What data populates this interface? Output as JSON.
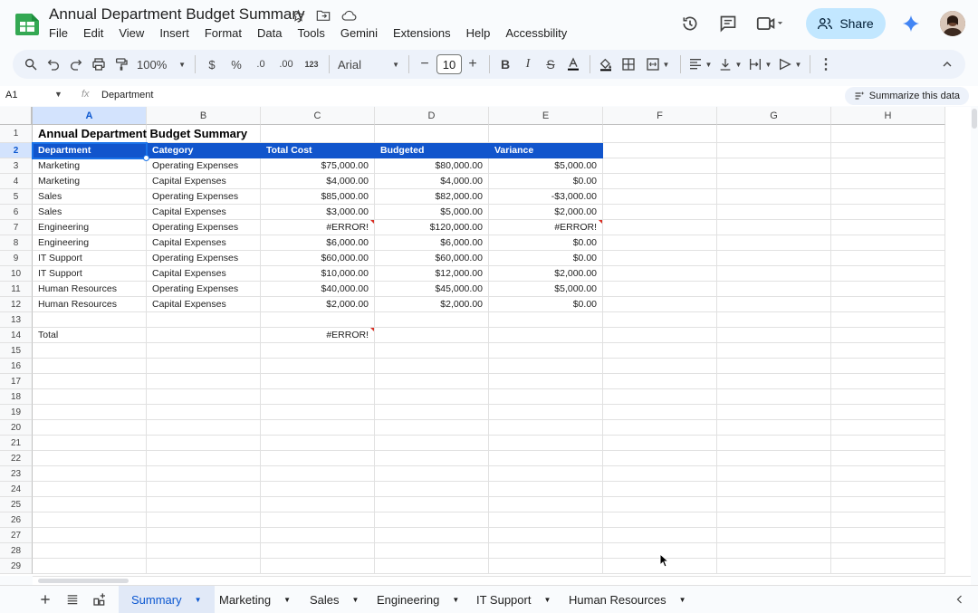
{
  "app": {
    "title": "Annual Department Budget Summary",
    "share_label": "Share"
  },
  "menu": [
    "File",
    "Edit",
    "View",
    "Insert",
    "Format",
    "Data",
    "Tools",
    "Gemini",
    "Extensions",
    "Help",
    "Accessbility"
  ],
  "toolbar": {
    "zoom": "100%",
    "font": "Arial",
    "font_size": "10",
    "currency": "$",
    "percent": "%",
    "dec_minus": ".0",
    "dec_plus": ".00",
    "number_format": "123"
  },
  "formula": {
    "name_box": "A1",
    "fx": "fx",
    "value": "Department",
    "summarize_label": "Summarize this data"
  },
  "columns": [
    "A",
    "B",
    "C",
    "D",
    "E",
    "F",
    "G",
    "H"
  ],
  "rows": [
    "1",
    "2",
    "3",
    "4",
    "5",
    "6",
    "7",
    "8",
    "9",
    "10",
    "11",
    "12",
    "13",
    "14",
    "15",
    "16",
    "17",
    "18",
    "19",
    "20",
    "21",
    "22",
    "23",
    "24",
    "25",
    "26",
    "27",
    "28",
    "29"
  ],
  "sheet_title": "Annual Department Budget Summary",
  "headers": [
    "Department",
    "Category",
    "Total Cost",
    "Budgeted",
    "Variance"
  ],
  "data": [
    [
      "Marketing",
      "Operating Expenses",
      "$75,000.00",
      "$80,000.00",
      "$5,000.00"
    ],
    [
      "Marketing",
      "Capital Expenses",
      "$4,000.00",
      "$4,000.00",
      "$0.00"
    ],
    [
      "Sales",
      "Operating Expenses",
      "$85,000.00",
      "$82,000.00",
      "-$3,000.00"
    ],
    [
      "Sales",
      "Capital Expenses",
      "$3,000.00",
      "$5,000.00",
      "$2,000.00"
    ],
    [
      "Engineering",
      "Operating Expenses",
      "#ERROR!",
      "$120,000.00",
      "#ERROR!"
    ],
    [
      "Engineering",
      "Capital Expenses",
      "$6,000.00",
      "$6,000.00",
      "$0.00"
    ],
    [
      "IT Support",
      "Operating Expenses",
      "$60,000.00",
      "$60,000.00",
      "$0.00"
    ],
    [
      "IT Support",
      "Capital Expenses",
      "$10,000.00",
      "$12,000.00",
      "$2,000.00"
    ],
    [
      "Human Resources",
      "Operating Expenses",
      "$40,000.00",
      "$45,000.00",
      "$5,000.00"
    ],
    [
      "Human Resources",
      "Capital Expenses",
      "$2,000.00",
      "$2,000.00",
      "$0.00"
    ]
  ],
  "total": {
    "label": "Total",
    "value": "#ERROR!"
  },
  "tabs": [
    {
      "label": "Summary",
      "active": true
    },
    {
      "label": "Marketing",
      "active": false
    },
    {
      "label": "Sales",
      "active": false
    },
    {
      "label": "Engineering",
      "active": false
    },
    {
      "label": "IT Support",
      "active": false
    },
    {
      "label": "Human Resources",
      "active": false
    }
  ],
  "colors": {
    "header_fill": "#1155cc",
    "selection": "#1a73e8",
    "share": "#c2e7ff",
    "error_marker": "#d93025"
  }
}
